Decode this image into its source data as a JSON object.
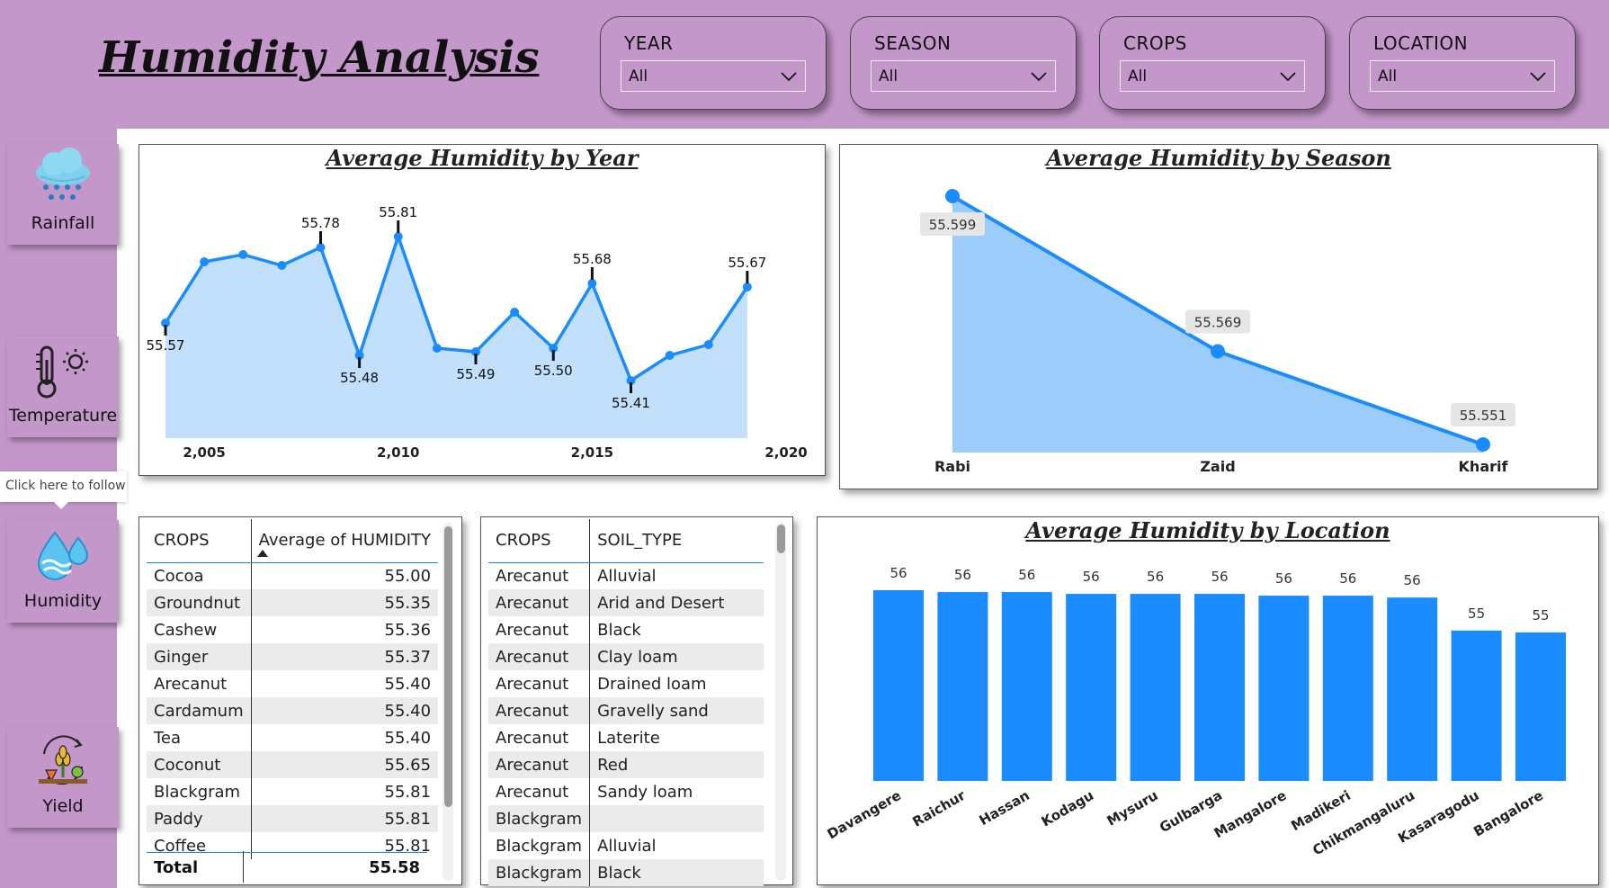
{
  "title": "Humidity Analysis",
  "filters": [
    {
      "label": "YEAR",
      "value": "All"
    },
    {
      "label": "SEASON",
      "value": "All"
    },
    {
      "label": "CROPS",
      "value": "All"
    },
    {
      "label": "LOCATION",
      "value": "All"
    }
  ],
  "nav": {
    "rainfall": "Rainfall",
    "temperature": "Temperature",
    "humidity": "Humidity",
    "yield": "Yield",
    "tooltip": "Click here to follow"
  },
  "colors": {
    "background": "#c497cb",
    "accent": "#1a8cff",
    "line_fill": "#c2e0fc",
    "area_fill": "#9ccdfa"
  },
  "year_chart": {
    "title": "Average Humidity by Year",
    "x_ticks": [
      "2,005",
      "2,010",
      "2,015",
      "2,020"
    ]
  },
  "season_chart": {
    "title": "Average Humidity by Season"
  },
  "location_chart": {
    "title": "Average Humidity by Location"
  },
  "chart_data": [
    {
      "type": "line",
      "title": "Average Humidity by Year",
      "x": [
        2004,
        2005,
        2006,
        2007,
        2008,
        2009,
        2010,
        2011,
        2012,
        2013,
        2014,
        2015,
        2016,
        2017,
        2018,
        2019
      ],
      "y": [
        55.57,
        55.74,
        55.76,
        55.73,
        55.78,
        55.48,
        55.81,
        55.5,
        55.49,
        55.6,
        55.5,
        55.68,
        55.41,
        55.48,
        55.51,
        55.67
      ],
      "point_labels": [
        "55.57",
        "",
        "",
        "",
        "55.78",
        "55.48",
        "55.81",
        "",
        "55.49",
        "",
        "55.50",
        "55.68",
        "55.41",
        "",
        "",
        "55.67"
      ],
      "x_ticks": [
        "2,005",
        "2,010",
        "2,015",
        "2,020"
      ],
      "xlim": [
        2004,
        2020
      ],
      "ylim": [
        55.39,
        55.86
      ]
    },
    {
      "type": "area",
      "title": "Average Humidity by Season",
      "categories": [
        "Rabi",
        "Zaid",
        "Kharif"
      ],
      "values": [
        55.599,
        55.569,
        55.551
      ],
      "data_labels": [
        "55.599",
        "55.569",
        "55.551"
      ]
    },
    {
      "type": "bar",
      "title": "Average Humidity by Location",
      "categories": [
        "Davangere",
        "Raichur",
        "Hassan",
        "Kodagu",
        "Mysuru",
        "Gulbarga",
        "Mangalore",
        "Madikeri",
        "Chikmangaluru",
        "Kasaragodu",
        "Bangalore"
      ],
      "values": [
        55.64,
        55.63,
        55.63,
        55.62,
        55.62,
        55.62,
        55.61,
        55.61,
        55.6,
        55.42,
        55.41
      ],
      "data_labels": [
        "56",
        "56",
        "56",
        "56",
        "56",
        "56",
        "56",
        "56",
        "56",
        "55",
        "55"
      ]
    }
  ],
  "crops_table": {
    "headers": [
      "CROPS",
      "Average of HUMIDITY"
    ],
    "rows": [
      [
        "Cocoa",
        "55.00"
      ],
      [
        "Groundnut",
        "55.35"
      ],
      [
        "Cashew",
        "55.36"
      ],
      [
        "Ginger",
        "55.37"
      ],
      [
        "Arecanut",
        "55.40"
      ],
      [
        "Cardamum",
        "55.40"
      ],
      [
        "Tea",
        "55.40"
      ],
      [
        "Coconut",
        "55.65"
      ],
      [
        "Blackgram",
        "55.81"
      ],
      [
        "Paddy",
        "55.81"
      ],
      [
        "Coffee",
        "55.81"
      ]
    ],
    "total": [
      "Total",
      "55.58"
    ]
  },
  "soil_table": {
    "headers": [
      "CROPS",
      "SOIL_TYPE"
    ],
    "rows": [
      [
        "Arecanut",
        "Alluvial"
      ],
      [
        "Arecanut",
        "Arid and Desert"
      ],
      [
        "Arecanut",
        "Black"
      ],
      [
        "Arecanut",
        "Clay loam"
      ],
      [
        "Arecanut",
        "Drained loam"
      ],
      [
        "Arecanut",
        "Gravelly sand"
      ],
      [
        "Arecanut",
        "Laterite"
      ],
      [
        "Arecanut",
        "Red"
      ],
      [
        "Arecanut",
        "Sandy loam"
      ],
      [
        "Blackgram",
        ""
      ],
      [
        "Blackgram",
        "Alluvial"
      ],
      [
        "Blackgram",
        "Black"
      ]
    ]
  }
}
